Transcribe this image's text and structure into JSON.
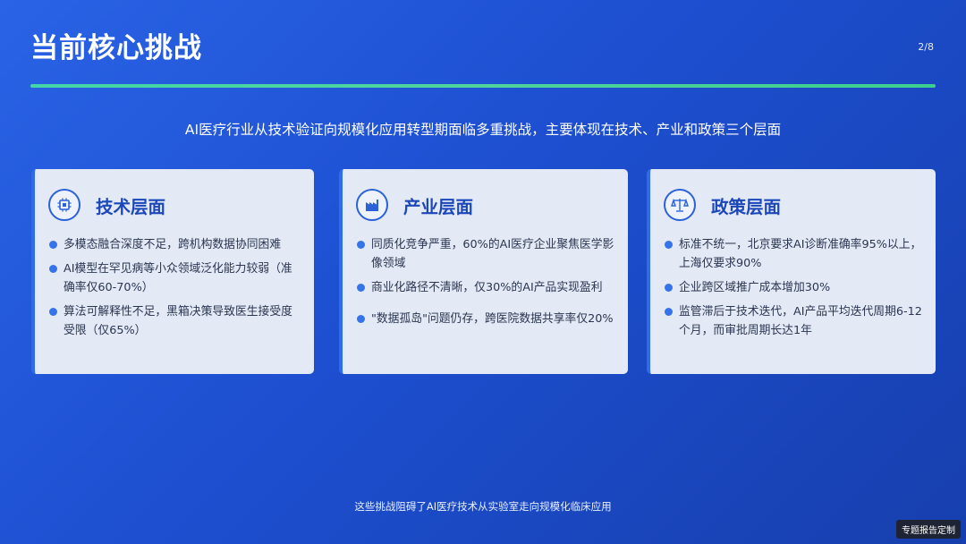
{
  "slide": {
    "title": "当前核心挑战",
    "page_indicator": "2/8",
    "subtitle": "AI医疗行业从技术验证向规模化应用转型期面临多重挑战，主要体现在技术、产业和政策三个层面",
    "footer_note": "这些挑战阻碍了AI医疗技术从实验室走向规模化临床应用",
    "badge": "专题报告定制"
  },
  "cards": [
    {
      "icon": "chip-icon",
      "title": "技术层面",
      "items": [
        "多模态融合深度不足，跨机构数据协同困难",
        "AI模型在罕见病等小众领域泛化能力较弱（准确率仅60-70%）",
        "算法可解释性不足，黑箱决策导致医生接受度受限（仅65%）"
      ]
    },
    {
      "icon": "factory-icon",
      "title": "产业层面",
      "items": [
        "同质化竞争严重，60%的AI医疗企业聚焦医学影像领域",
        "商业化路径不清晰，仅30%的AI产品实现盈利",
        "\"数据孤岛\"问题仍存，跨医院数据共享率仅20%"
      ]
    },
    {
      "icon": "scale-icon",
      "title": "政策层面",
      "items": [
        "标准不统一，北京要求AI诊断准确率95%以上，上海仅要求90%",
        "企业跨区域推广成本增加30%",
        "监管滞后于技术迭代，AI产品平均迭代周期6-12个月，而审批周期长达1年"
      ]
    }
  ],
  "colors": {
    "background": "#1d4fd0",
    "accent_line": "#43d6a6",
    "card_bg": "#e3e9f5",
    "card_title": "#1b47b8",
    "bullet": "#3574e8"
  }
}
